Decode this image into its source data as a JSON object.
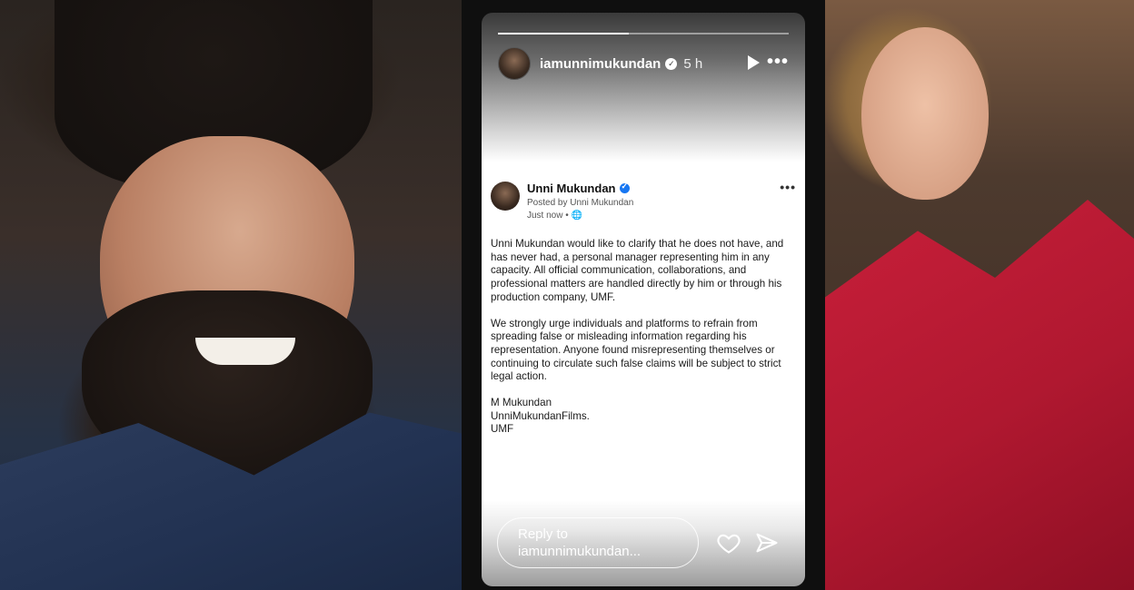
{
  "story": {
    "username": "iamunnimukundan",
    "time": "5 h",
    "progress": 0.45,
    "more_label": "•••",
    "reply_placeholder": "Reply to iamunnimukundan..."
  },
  "post": {
    "author": "Unni Mukundan",
    "posted_by": "Posted by Unni Mukundan",
    "time": "Just now • ",
    "more_label": "•••",
    "paragraph1": "Unni Mukundan would like to clarify that he does not have, and has never had, a personal manager representing him in any capacity. All official communication, collaborations, and professional matters are handled directly by him or through his production company, UMF.",
    "paragraph2": "We strongly urge individuals and platforms to refrain from spreading false or misleading information regarding his representation. Anyone found misrepresenting themselves or continuing to circulate such false claims will be subject to strict legal action.",
    "signature": [
      "M Mukundan",
      "UnniMukundanFilms.",
      "UMF"
    ]
  },
  "colors": {
    "verified_blue": "#1877f2",
    "dress_red": "#c81f3a"
  }
}
